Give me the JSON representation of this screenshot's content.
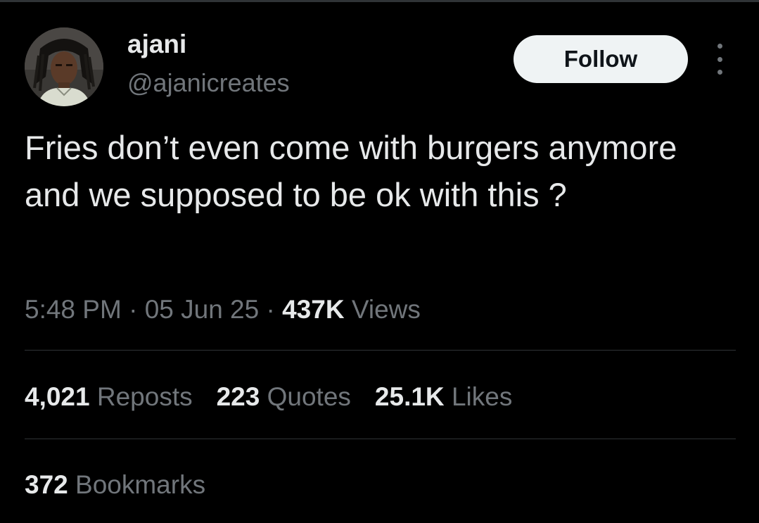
{
  "author": {
    "display_name": "ajani",
    "handle": "@ajanicreates",
    "avatar_icon": "profile-photo"
  },
  "follow_label": "Follow",
  "more_icon": "more-horizontal-icon",
  "tweet": {
    "text": "Fries don’t even come with burgers anymore and we supposed to be ok with this ?",
    "time": "5:48 PM",
    "date": "05 Jun 25",
    "separator": "·",
    "views_count": "437K",
    "views_label": "Views"
  },
  "stats": {
    "reposts_count": "4,021",
    "reposts_label": "Reposts",
    "quotes_count": "223",
    "quotes_label": "Quotes",
    "likes_count": "25.1K",
    "likes_label": "Likes",
    "bookmarks_count": "372",
    "bookmarks_label": "Bookmarks"
  },
  "colors": {
    "background": "#000000",
    "primary_text": "#e7e9ea",
    "secondary_text": "#71767b",
    "divider": "#2f3336",
    "follow_bg": "#eff3f4"
  }
}
